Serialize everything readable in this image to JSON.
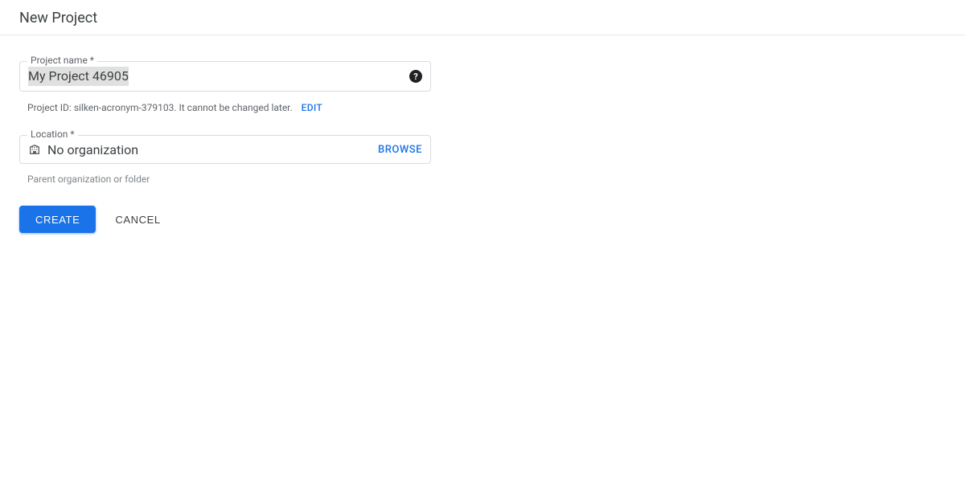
{
  "header": {
    "title": "New Project"
  },
  "form": {
    "project_name": {
      "label": "Project name *",
      "value": "My Project 46905",
      "help_tooltip": "?"
    },
    "project_id_helper": {
      "prefix": "Project ID:",
      "id": "silken-acronym-379103.",
      "note_prefix": "It",
      "note_rest": " cannot be changed later.",
      "edit_label": "EDIT"
    },
    "location": {
      "label": "Location *",
      "value": "No organization",
      "browse_label": "BROWSE",
      "helper": "Parent organization or folder"
    },
    "actions": {
      "create": "CREATE",
      "cancel": "CANCEL"
    }
  },
  "colors": {
    "primary": "#1a73e8"
  }
}
